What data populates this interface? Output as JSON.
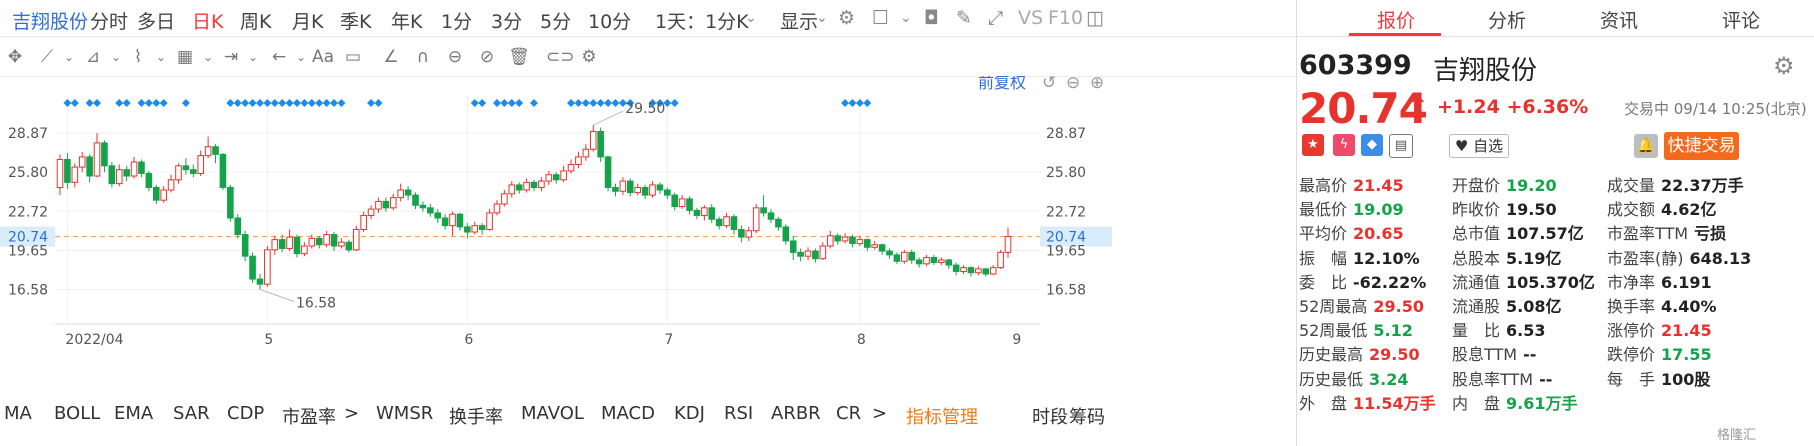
{
  "period_bar": {
    "stock_name": "吉翔股份",
    "items": [
      "分时",
      "多日",
      "日K",
      "周K",
      "月K",
      "季K",
      "年K",
      "1分",
      "3分",
      "5分",
      "10分",
      "1天：1分K",
      "显示",
      "VS",
      "F10"
    ],
    "active": "日K"
  },
  "toolbar": {
    "text_tool": "Aa",
    "icons": [
      "crosshair-icon",
      "line-icon",
      "ray-icon",
      "wave-icon",
      "fib-icon",
      "measure-icon",
      "arrow-icon",
      "text-icon",
      "comment-icon",
      "ruler-icon",
      "magnet-icon",
      "eye-icon",
      "hide-icon",
      "delete-icon",
      "compare-icon",
      "settings-icon"
    ]
  },
  "chart": {
    "adjust_label": "前复权",
    "price_labels": [
      "28.87",
      "25.80",
      "22.72",
      "20.74",
      "19.65",
      "16.58"
    ],
    "current_price_tag": "20.74",
    "x_labels": [
      "2022/04",
      "5",
      "6",
      "7",
      "8",
      "9"
    ],
    "annot_high": "29.50",
    "annot_low": "16.58"
  },
  "chart_data": {
    "type": "candlestick",
    "x": [
      "2022/04",
      "5",
      "6",
      "7",
      "8",
      "9"
    ],
    "ylim": [
      14.5,
      31.0
    ],
    "y_ticks": [
      16.58,
      19.65,
      22.72,
      25.8,
      28.87
    ],
    "current_price": 20.74,
    "annotated_high": 29.5,
    "annotated_low": 16.58,
    "candles": [
      [
        24.6,
        26.8,
        27.2,
        24.0
      ],
      [
        26.8,
        25.0,
        27.3,
        24.5
      ],
      [
        25.0,
        26.2,
        26.5,
        24.6
      ],
      [
        26.2,
        27.0,
        27.4,
        25.8
      ],
      [
        27.0,
        25.5,
        27.2,
        25.0
      ],
      [
        25.5,
        28.1,
        28.87,
        25.4
      ],
      [
        28.1,
        26.3,
        28.3,
        25.8
      ],
      [
        26.3,
        24.9,
        26.6,
        24.6
      ],
      [
        24.9,
        26.0,
        26.4,
        24.7
      ],
      [
        26.0,
        25.5,
        26.3,
        25.1
      ],
      [
        25.5,
        26.6,
        27.0,
        25.3
      ],
      [
        26.6,
        25.7,
        26.8,
        25.4
      ],
      [
        25.7,
        24.6,
        25.9,
        24.3
      ],
      [
        24.6,
        23.6,
        24.8,
        23.3
      ],
      [
        23.6,
        24.4,
        24.7,
        23.4
      ],
      [
        24.4,
        25.2,
        25.6,
        24.2
      ],
      [
        25.2,
        26.3,
        26.5,
        24.9
      ],
      [
        26.3,
        26.0,
        26.9,
        25.6
      ],
      [
        26.0,
        25.7,
        26.4,
        25.4
      ],
      [
        25.7,
        27.1,
        27.5,
        25.5
      ],
      [
        27.1,
        27.8,
        28.6,
        26.9
      ],
      [
        27.8,
        27.2,
        28.0,
        26.5
      ],
      [
        27.2,
        24.6,
        27.3,
        24.4
      ],
      [
        24.6,
        22.2,
        24.8,
        21.9
      ],
      [
        22.2,
        20.9,
        22.5,
        20.6
      ],
      [
        20.9,
        19.2,
        21.2,
        18.8
      ],
      [
        19.2,
        17.4,
        19.5,
        17.1
      ],
      [
        17.4,
        17.0,
        17.8,
        16.58
      ],
      [
        17.0,
        19.7,
        20.0,
        16.8
      ],
      [
        19.7,
        20.5,
        20.8,
        19.3
      ],
      [
        20.5,
        19.8,
        20.9,
        19.5
      ],
      [
        19.8,
        20.7,
        21.3,
        19.6
      ],
      [
        20.7,
        19.4,
        20.9,
        19.1
      ],
      [
        19.4,
        20.0,
        20.3,
        19.2
      ],
      [
        20.0,
        20.6,
        20.9,
        19.8
      ],
      [
        20.6,
        20.1,
        20.8,
        19.8
      ],
      [
        20.1,
        20.9,
        21.2,
        19.9
      ],
      [
        20.9,
        20.0,
        21.1,
        19.6
      ],
      [
        20.0,
        20.3,
        20.6,
        19.8
      ],
      [
        20.3,
        19.7,
        20.5,
        19.5
      ],
      [
        19.7,
        21.3,
        21.6,
        19.6
      ],
      [
        21.3,
        22.4,
        22.7,
        21.1
      ],
      [
        22.4,
        22.9,
        23.2,
        22.1
      ],
      [
        22.9,
        23.5,
        23.8,
        22.6
      ],
      [
        23.5,
        23.0,
        23.8,
        22.7
      ],
      [
        23.0,
        23.8,
        24.1,
        22.8
      ],
      [
        23.8,
        24.4,
        24.9,
        23.5
      ],
      [
        24.4,
        24.0,
        24.7,
        23.6
      ],
      [
        24.0,
        23.2,
        24.2,
        22.9
      ],
      [
        23.2,
        23.0,
        23.5,
        22.7
      ],
      [
        23.0,
        22.6,
        23.3,
        22.3
      ],
      [
        22.6,
        22.2,
        22.9,
        21.8
      ],
      [
        22.2,
        21.6,
        22.5,
        21.3
      ],
      [
        21.6,
        22.5,
        22.7,
        20.8
      ],
      [
        22.5,
        21.5,
        22.6,
        21.2
      ],
      [
        21.5,
        21.1,
        21.8,
        20.6
      ],
      [
        21.1,
        21.6,
        21.9,
        20.9
      ],
      [
        21.6,
        21.3,
        21.8,
        20.9
      ],
      [
        21.3,
        22.6,
        22.9,
        21.2
      ],
      [
        22.6,
        23.3,
        23.6,
        22.4
      ],
      [
        23.3,
        24.1,
        24.4,
        23.1
      ],
      [
        24.1,
        24.8,
        25.1,
        23.8
      ],
      [
        24.8,
        24.4,
        25.0,
        24.1
      ],
      [
        24.4,
        25.0,
        25.3,
        24.2
      ],
      [
        25.0,
        24.6,
        25.2,
        24.3
      ],
      [
        24.6,
        25.1,
        25.4,
        24.3
      ],
      [
        25.1,
        25.6,
        25.9,
        24.8
      ],
      [
        25.6,
        25.2,
        25.8,
        24.9
      ],
      [
        25.2,
        25.9,
        26.3,
        25.0
      ],
      [
        25.9,
        26.4,
        26.8,
        25.7
      ],
      [
        26.4,
        27.0,
        27.4,
        26.1
      ],
      [
        27.0,
        27.6,
        28.0,
        26.7
      ],
      [
        27.6,
        29.0,
        29.5,
        27.4
      ],
      [
        29.0,
        27.0,
        29.3,
        26.6
      ],
      [
        27.0,
        24.6,
        27.1,
        24.3
      ],
      [
        24.6,
        24.3,
        24.9,
        23.9
      ],
      [
        24.3,
        25.1,
        25.4,
        24.0
      ],
      [
        25.1,
        24.2,
        25.3,
        23.9
      ],
      [
        24.2,
        24.6,
        24.9,
        24.0
      ],
      [
        24.6,
        24.0,
        24.8,
        23.7
      ],
      [
        24.0,
        24.8,
        25.1,
        23.8
      ],
      [
        24.8,
        24.4,
        25.0,
        24.1
      ],
      [
        24.4,
        24.0,
        24.6,
        23.7
      ],
      [
        24.0,
        23.1,
        24.2,
        22.8
      ],
      [
        23.1,
        23.7,
        24.0,
        22.9
      ],
      [
        23.7,
        22.8,
        23.9,
        22.5
      ],
      [
        22.8,
        22.4,
        23.0,
        22.1
      ],
      [
        22.4,
        23.0,
        23.2,
        22.0
      ],
      [
        23.0,
        22.1,
        23.3,
        21.8
      ],
      [
        22.1,
        21.6,
        22.3,
        21.3
      ],
      [
        21.6,
        22.3,
        22.6,
        21.4
      ],
      [
        22.3,
        21.3,
        22.5,
        20.9
      ],
      [
        21.3,
        20.7,
        21.6,
        20.3
      ],
      [
        20.7,
        21.2,
        21.5,
        20.4
      ],
      [
        21.2,
        23.0,
        23.3,
        21.0
      ],
      [
        23.0,
        22.6,
        24.0,
        22.3
      ],
      [
        22.6,
        22.1,
        22.9,
        21.8
      ],
      [
        22.1,
        21.5,
        22.3,
        21.2
      ],
      [
        21.5,
        20.4,
        21.7,
        20.1
      ],
      [
        20.4,
        19.5,
        20.8,
        18.9
      ],
      [
        19.5,
        19.2,
        19.8,
        18.8
      ],
      [
        19.2,
        19.6,
        19.9,
        18.9
      ],
      [
        19.6,
        19.0,
        19.8,
        18.7
      ],
      [
        19.0,
        20.0,
        20.3,
        18.9
      ],
      [
        20.0,
        20.8,
        21.2,
        19.8
      ],
      [
        20.8,
        20.4,
        21.0,
        20.1
      ],
      [
        20.4,
        20.7,
        21.0,
        20.2
      ],
      [
        20.7,
        20.2,
        20.9,
        19.9
      ],
      [
        20.2,
        20.5,
        20.8,
        20.0
      ],
      [
        20.5,
        19.9,
        20.6,
        19.6
      ],
      [
        19.9,
        20.1,
        20.4,
        19.7
      ],
      [
        20.1,
        19.6,
        20.2,
        19.3
      ],
      [
        19.6,
        19.3,
        19.8,
        19.0
      ],
      [
        19.3,
        18.8,
        19.5,
        18.6
      ],
      [
        18.8,
        19.5,
        19.7,
        18.6
      ],
      [
        19.5,
        18.9,
        19.7,
        18.6
      ],
      [
        18.9,
        18.6,
        19.1,
        18.3
      ],
      [
        18.6,
        19.1,
        19.3,
        18.4
      ],
      [
        19.1,
        18.7,
        19.3,
        18.5
      ],
      [
        18.7,
        18.9,
        19.1,
        18.5
      ],
      [
        18.9,
        18.5,
        19.0,
        18.2
      ],
      [
        18.5,
        18.0,
        18.7,
        17.7
      ],
      [
        18.0,
        18.3,
        18.5,
        17.8
      ],
      [
        18.3,
        17.9,
        18.4,
        17.6
      ],
      [
        17.9,
        18.2,
        18.4,
        17.7
      ],
      [
        18.2,
        17.8,
        18.3,
        17.6
      ],
      [
        17.8,
        18.3,
        18.5,
        17.7
      ],
      [
        18.3,
        19.5,
        19.7,
        18.2
      ],
      [
        19.5,
        20.74,
        21.45,
        19.09
      ]
    ]
  },
  "indicators": [
    "MA",
    "BOLL",
    "EMA",
    "SAR",
    "CDP",
    "市盈率",
    ">",
    "WMSR",
    "换手率",
    "MAVOL",
    "MACD",
    "KDJ",
    "RSI",
    "ARBR",
    "CR",
    ">",
    "指标管理",
    "时段",
    "筹码"
  ],
  "tabs": [
    "报价",
    "分析",
    "资讯",
    "评论"
  ],
  "quote": {
    "code": "603399",
    "name": "吉翔股份",
    "price": "20.74",
    "change": "+1.24",
    "change_pct": "+6.36%",
    "status": "交易中 09/14 10:25(北京)",
    "watch_label": "自选",
    "quick_trade": "快捷交易",
    "rows": [
      [
        {
          "label": "最高价",
          "value": "21.45",
          "color": "red"
        },
        {
          "label": "开盘价",
          "value": "19.20",
          "color": "green"
        },
        {
          "label": "成交量",
          "value": "22.37万手",
          "color": "dark"
        }
      ],
      [
        {
          "label": "最低价",
          "value": "19.09",
          "color": "green"
        },
        {
          "label": "昨收价",
          "value": "19.50",
          "color": "dark"
        },
        {
          "label": "成交额",
          "value": "4.62亿",
          "color": "dark"
        }
      ],
      [
        {
          "label": "平均价",
          "value": "20.65",
          "color": "red"
        },
        {
          "label": "总市值",
          "value": "107.57亿",
          "color": "dark"
        },
        {
          "label": "市盈率TTM",
          "value": "亏损",
          "color": "dark"
        }
      ],
      [
        {
          "label": "振　幅",
          "value": "12.10%",
          "color": "dark"
        },
        {
          "label": "总股本",
          "value": "5.19亿",
          "color": "dark"
        },
        {
          "label": "市盈率(静)",
          "value": "648.13",
          "color": "dark"
        }
      ],
      [
        {
          "label": "委　比",
          "value": "-62.22%",
          "color": "dark"
        },
        {
          "label": "流通值",
          "value": "105.370亿",
          "color": "dark"
        },
        {
          "label": "市净率",
          "value": "6.191",
          "color": "dark"
        }
      ],
      [
        {
          "label": "52周最高",
          "value": "29.50",
          "color": "red"
        },
        {
          "label": "流通股",
          "value": "5.08亿",
          "color": "dark"
        },
        {
          "label": "换手率",
          "value": "4.40%",
          "color": "dark"
        }
      ],
      [
        {
          "label": "52周最低",
          "value": "5.12",
          "color": "green"
        },
        {
          "label": "量　比",
          "value": "6.53",
          "color": "dark"
        },
        {
          "label": "涨停价",
          "value": "21.45",
          "color": "red"
        }
      ],
      [
        {
          "label": "历史最高",
          "value": "29.50",
          "color": "red"
        },
        {
          "label": "股息TTM",
          "value": "--",
          "color": "dark"
        },
        {
          "label": "跌停价",
          "value": "17.55",
          "color": "green"
        }
      ],
      [
        {
          "label": "历史最低",
          "value": "3.24",
          "color": "green"
        },
        {
          "label": "股息率TTM",
          "value": "--",
          "color": "dark"
        },
        {
          "label": "每　手",
          "value": "100股",
          "color": "dark"
        }
      ],
      [
        {
          "label": "外　盘",
          "value": "11.54万手",
          "color": "red"
        },
        {
          "label": "内　盘",
          "value": "9.61万手",
          "color": "green"
        }
      ]
    ],
    "watermark": "格隆汇"
  },
  "colors": {
    "up": "#e8322e",
    "down": "#14a34a",
    "accent": "#ef3b3b",
    "orange": "#f26b1d",
    "marker": "#1a8cf0"
  }
}
